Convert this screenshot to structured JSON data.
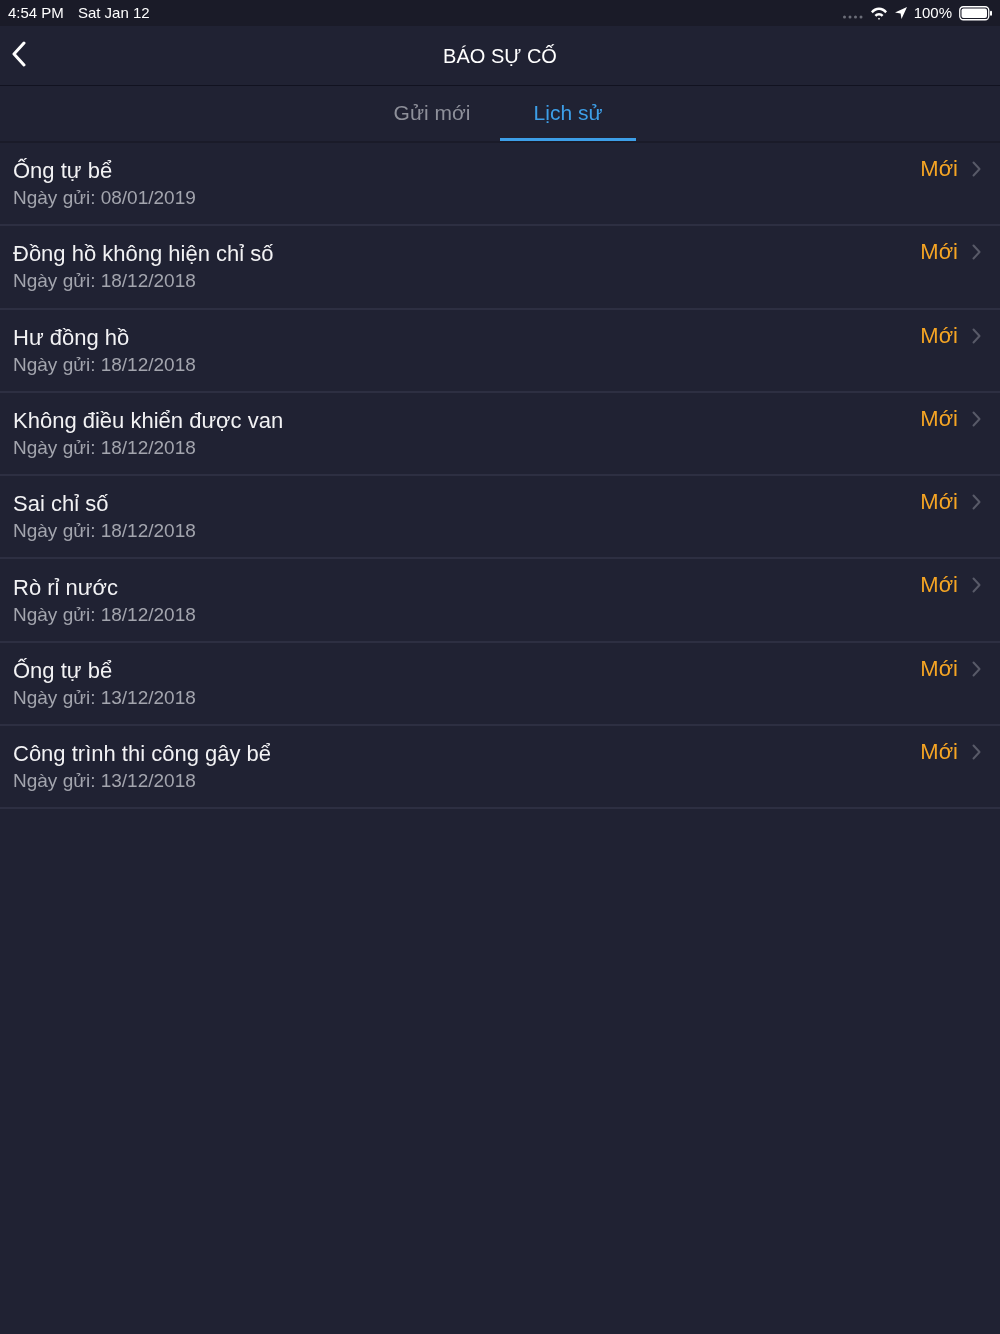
{
  "status_bar": {
    "time": "4:54 PM",
    "date": "Sat Jan 12",
    "battery": "100%"
  },
  "nav_bar": {
    "title": "BÁO SỰ CỐ"
  },
  "tabs": [
    {
      "label": "Gửi mới",
      "selected": false
    },
    {
      "label": "Lịch sử",
      "selected": true
    }
  ],
  "reports": [
    {
      "title": "Ống tự bể",
      "date": "Ngày gửi: 08/01/2019",
      "status": "Mới"
    },
    {
      "title": "Đồng hồ không hiện chỉ số",
      "date": "Ngày gửi: 18/12/2018",
      "status": "Mới"
    },
    {
      "title": "Hư đồng hồ",
      "date": "Ngày gửi: 18/12/2018",
      "status": "Mới"
    },
    {
      "title": "Không điều khiển được van",
      "date": "Ngày gửi: 18/12/2018",
      "status": "Mới"
    },
    {
      "title": "Sai chỉ số",
      "date": "Ngày gửi: 18/12/2018",
      "status": "Mới"
    },
    {
      "title": "Rò rỉ nước",
      "date": "Ngày gửi: 18/12/2018",
      "status": "Mới"
    },
    {
      "title": "Ống tự bể",
      "date": "Ngày gửi: 13/12/2018",
      "status": "Mới"
    },
    {
      "title": "Công trình thi công gây bể",
      "date": "Ngày gửi: 13/12/2018",
      "status": "Mới"
    }
  ]
}
